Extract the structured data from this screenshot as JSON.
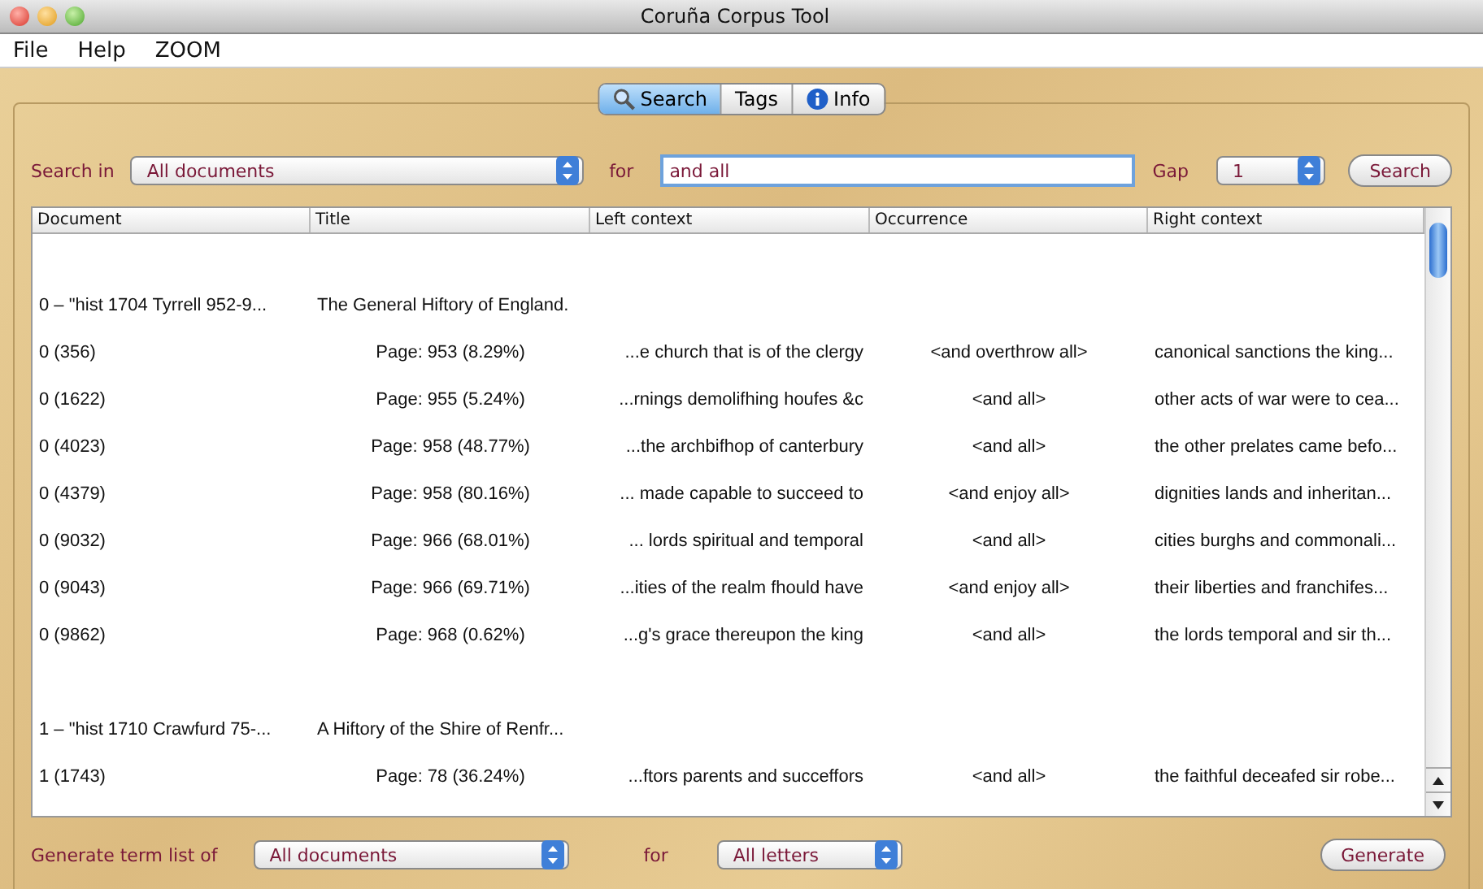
{
  "window": {
    "title": "Coruña Corpus Tool"
  },
  "menu": [
    "File",
    "Help",
    "ZOOM"
  ],
  "tabs": [
    {
      "label": "Search",
      "kind": "search",
      "selected": true
    },
    {
      "label": "Tags",
      "selected": false
    },
    {
      "label": "Info",
      "kind": "info",
      "selected": false
    }
  ],
  "search_bar": {
    "search_in_label": "Search in",
    "search_in_value": "All documents",
    "for_label": "for",
    "query": "and all",
    "gap_label": "Gap",
    "gap_value": "1",
    "button": "Search"
  },
  "table": {
    "columns": [
      "Document",
      "Title",
      "Left context",
      "Occurrence",
      "Right context"
    ],
    "rows": [
      {
        "kind": "group",
        "document": "0 – \"hist 1704 Tyrrell 952-9...",
        "title": "The General Hiftory of England."
      },
      {
        "kind": "hit",
        "document": "0 (356)",
        "title": "Page: 953 (8.29%)",
        "left": "...e church that is of the clergy",
        "occurrence": "<and overthrow all>",
        "right": "canonical sanctions the king..."
      },
      {
        "kind": "hit",
        "document": "0 (1622)",
        "title": "Page: 955 (5.24%)",
        "left": "...rnings demolifhing houfes &c",
        "occurrence": "<and all>",
        "right": "other acts of war were to cea..."
      },
      {
        "kind": "hit",
        "document": "0 (4023)",
        "title": "Page: 958 (48.77%)",
        "left": "...the archbifhop of canterbury",
        "occurrence": "<and all>",
        "right": "the other prelates came befo..."
      },
      {
        "kind": "hit",
        "document": "0 (4379)",
        "title": "Page: 958 (80.16%)",
        "left": "... made capable to succeed to",
        "occurrence": "<and enjoy all>",
        "right": "dignities lands and inheritan..."
      },
      {
        "kind": "hit",
        "document": "0 (9032)",
        "title": "Page: 966 (68.01%)",
        "left": "... lords spiritual and temporal",
        "occurrence": "<and all>",
        "right": "cities burghs and commonali..."
      },
      {
        "kind": "hit",
        "document": "0 (9043)",
        "title": "Page: 966 (69.71%)",
        "left": "...ities of the realm fhould have",
        "occurrence": "<and enjoy all>",
        "right": "their liberties and franchifes..."
      },
      {
        "kind": "hit",
        "document": "0 (9862)",
        "title": "Page: 968 (0.62%)",
        "left": "...g's grace thereupon the king",
        "occurrence": "<and all>",
        "right": "the lords temporal and sir th..."
      },
      {
        "kind": "group",
        "document": "1 – \"hist 1710 Crawfurd 75-...",
        "title": "A Hiftory of the Shire of Renfr..."
      },
      {
        "kind": "hit",
        "document": "1 (1743)",
        "title": "Page: 78 (36.24%)",
        "left": "...ftors parents and succeffors",
        "occurrence": "<and all>",
        "right": "the faithful deceafed sir robe..."
      }
    ]
  },
  "term_bar": {
    "label": "Generate term list of",
    "documents_value": "All documents",
    "for_label": "for",
    "letters_value": "All letters",
    "button": "Generate"
  }
}
